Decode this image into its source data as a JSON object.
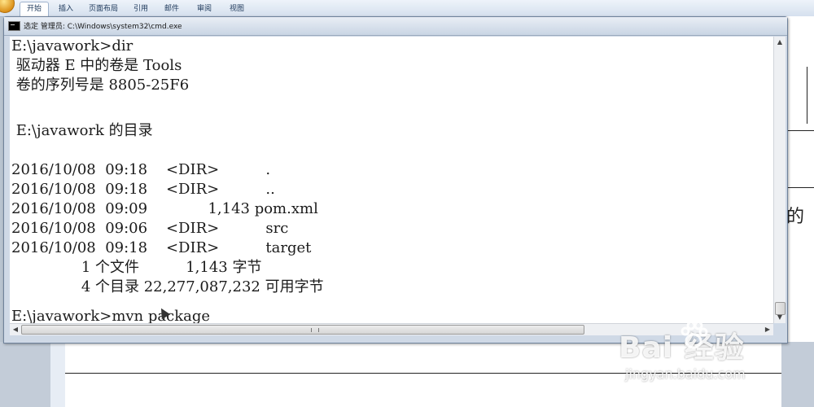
{
  "ribbon": {
    "tabs": [
      {
        "label": "开始",
        "active": true
      },
      {
        "label": "插入",
        "active": false
      },
      {
        "label": "页面布局",
        "active": false
      },
      {
        "label": "引用",
        "active": false
      },
      {
        "label": "邮件",
        "active": false
      },
      {
        "label": "审阅",
        "active": false
      },
      {
        "label": "视图",
        "active": false
      }
    ]
  },
  "cmd_window": {
    "title": "选定 管理员: C:\\Windows\\system32\\cmd.exe",
    "lines": [
      "E:\\javawork>dir",
      " 驱动器 E 中的卷是 Tools",
      " 卷的序列号是 8805-25F6",
      "",
      " E:\\javawork 的目录",
      "",
      "2016/10/08  09:18    <DIR>          .",
      "2016/10/08  09:18    <DIR>          ..",
      "2016/10/08  09:09             1,143 pom.xml",
      "2016/10/08  09:06    <DIR>          src",
      "2016/10/08  09:18    <DIR>          target",
      "               1 个文件          1,143 字节",
      "               4 个目录 22,277,087,232 可用字节",
      "",
      "E:\\javawork>mvn package"
    ]
  },
  "background_doc": {
    "visible_char": "的"
  },
  "watermark": {
    "logo": "Bai  经验",
    "url": "jingyan.baidu.com"
  },
  "colors": {
    "console_bg": "#ffffff",
    "console_text": "#1b1b1b",
    "titlebar": "#d3dde9"
  }
}
